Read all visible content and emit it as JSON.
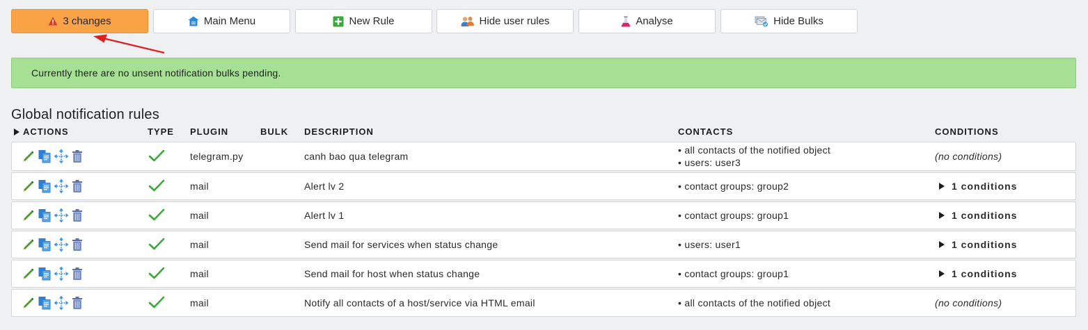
{
  "toolbar": {
    "changes_label": "3 changes",
    "main_menu_label": "Main Menu",
    "new_rule_label": "New Rule",
    "hide_user_rules_label": "Hide user rules",
    "analyse_label": "Analyse",
    "hide_bulks_label": "Hide Bulks"
  },
  "message": "Currently there are no unsent notification bulks pending.",
  "section_title": "Global notification rules",
  "columns": {
    "actions": "ACTIONS",
    "type": "TYPE",
    "plugin": "PLUGIN",
    "bulk": "BULK",
    "description": "DESCRIPTION",
    "contacts": "CONTACTS",
    "conditions": "CONDITIONS"
  },
  "rules": [
    {
      "plugin": "telegram.py",
      "bulk": "",
      "description": "canh bao qua telegram",
      "contacts": [
        "• all contacts of the notified object",
        "• users: user3"
      ],
      "conditions": "(no conditions)"
    },
    {
      "plugin": "mail",
      "bulk": "",
      "description": "Alert lv 2",
      "contacts": [
        "• contact groups: group2"
      ],
      "conditions": "1 conditions"
    },
    {
      "plugin": "mail",
      "bulk": "",
      "description": "Alert lv 1",
      "contacts": [
        "• contact groups: group1"
      ],
      "conditions": "1 conditions"
    },
    {
      "plugin": "mail",
      "bulk": "",
      "description": "Send mail for services when status change",
      "contacts": [
        "• users: user1"
      ],
      "conditions": "1 conditions"
    },
    {
      "plugin": "mail",
      "bulk": "",
      "description": "Send mail for host when status change",
      "contacts": [
        "• contact groups: group1"
      ],
      "conditions": "1 conditions"
    },
    {
      "plugin": "mail",
      "bulk": "",
      "description": "Notify all contacts of a host/service via HTML email",
      "contacts": [
        "• all contacts of the notified object"
      ],
      "conditions": "(no conditions)"
    }
  ],
  "colors": {
    "changes_button": "#f9a346",
    "message_bg": "#a6e094",
    "check": "#3aa83a",
    "pencil": "#4d9a2e",
    "annotation_arrow": "#e02020"
  },
  "icons": {
    "changes": "warning-icon",
    "main_menu": "home-icon",
    "new_rule": "plus-icon",
    "hide_user_rules": "users-icon",
    "analyse": "flask-icon",
    "hide_bulks": "bulk-icon",
    "row_actions": [
      "edit-icon",
      "clone-icon",
      "move-icon",
      "delete-icon"
    ],
    "type": "check-icon"
  }
}
